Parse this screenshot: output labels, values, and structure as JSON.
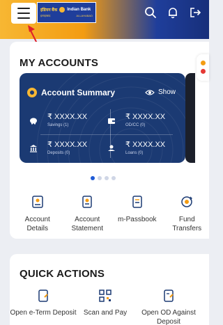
{
  "header": {
    "logo_text_hi": "इंडियन बैंक",
    "logo_text_en": "Indian Bank",
    "logo_sub_left": "इलाहाबाद",
    "logo_sub_right": "ALLAHABAD",
    "icons": [
      "search-icon",
      "bell-icon",
      "logout-icon"
    ]
  },
  "accounts": {
    "title": "MY ACCOUNTS",
    "summary": {
      "title": "Account Summary",
      "show_label": "Show",
      "cells": [
        {
          "amount": "₹ XXXX.XX",
          "label": "Savings (1)",
          "icon": "piggy-bank-icon"
        },
        {
          "amount": "₹ XXXX.XX",
          "label": "OD/CC (0)",
          "icon": "wallet-icon"
        },
        {
          "amount": "₹ XXXX.XX",
          "label": "Deposits (0)",
          "icon": "bank-icon"
        },
        {
          "amount": "₹ XXXX.XX",
          "label": "Loans (0)",
          "icon": "loan-icon"
        }
      ]
    },
    "pager": {
      "count": 4,
      "active": 0
    },
    "actions": [
      {
        "label": "Account Details",
        "icon": "account-details-icon"
      },
      {
        "label": "Account Statement",
        "icon": "statement-icon"
      },
      {
        "label": "m-Passbook",
        "icon": "passbook-icon"
      },
      {
        "label": "Fund Transfers",
        "icon": "fund-transfer-icon"
      }
    ]
  },
  "quick_actions": {
    "title": "QUICK ACTIONS",
    "items": [
      {
        "label": "Open e-Term Deposit",
        "icon": "term-deposit-icon"
      },
      {
        "label": "Scan and Pay",
        "icon": "qr-scan-icon"
      },
      {
        "label": "Open OD Against Deposit",
        "icon": "od-deposit-icon"
      }
    ]
  },
  "colors": {
    "brand_blue": "#1f3e9b",
    "brand_orange": "#f39c12",
    "card_navy": "#1b3a73",
    "accent": "#f7b733"
  }
}
